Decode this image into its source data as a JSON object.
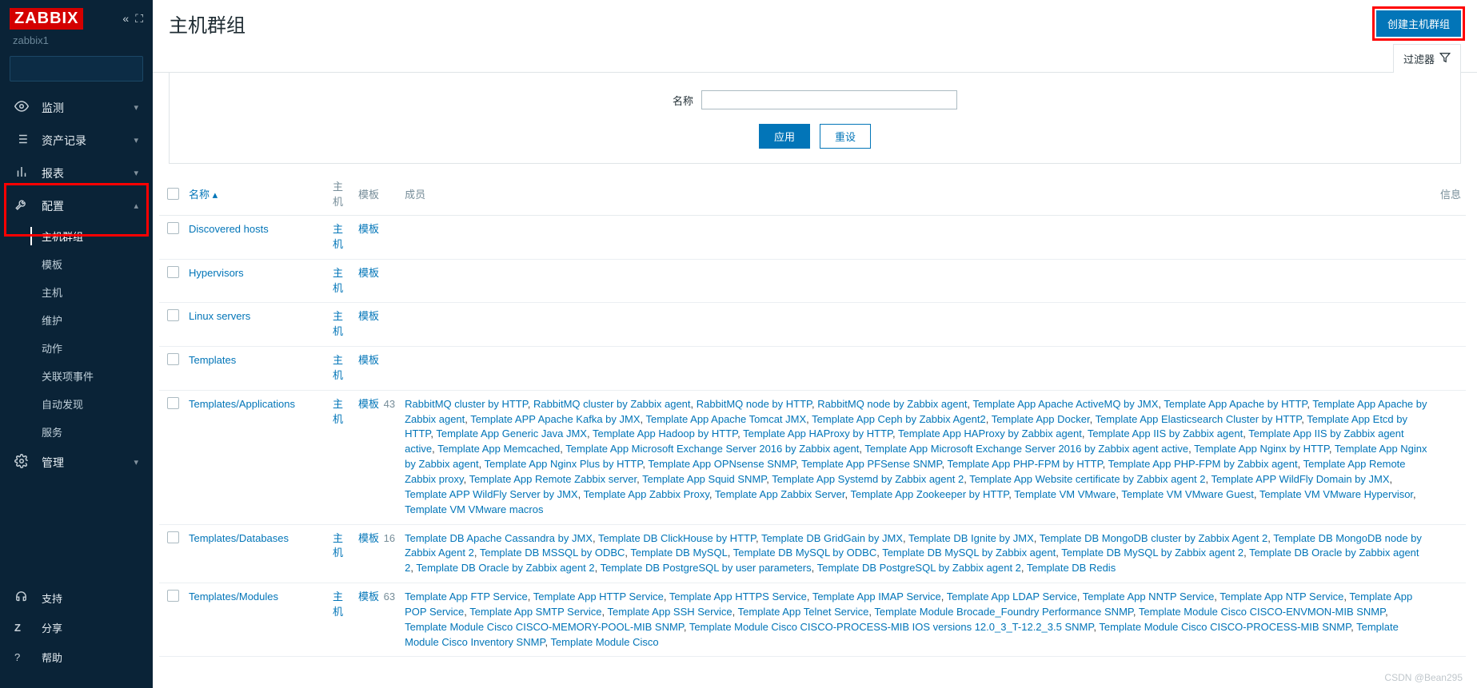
{
  "brand": "ZABBIX",
  "server": "zabbix1",
  "nav": {
    "monitor": "监测",
    "inventory": "资产记录",
    "reports": "报表",
    "config": "配置",
    "admin": "管理",
    "support": "支持",
    "share": "分享",
    "help": "帮助"
  },
  "config_sub": {
    "hostgroups": "主机群组",
    "templates": "模板",
    "hosts": "主机",
    "maintenance": "维护",
    "actions": "动作",
    "correlation": "关联项事件",
    "discovery": "自动发现",
    "services": "服务"
  },
  "page": {
    "title": "主机群组",
    "create_btn": "创建主机群组",
    "filter_tab": "过滤器",
    "filter_name_label": "名称",
    "apply": "应用",
    "reset": "重设"
  },
  "columns": {
    "name": "名称",
    "hosts": "主机",
    "templates": "模板",
    "members": "成员",
    "info": "信息"
  },
  "links": {
    "hosts": "主机",
    "templates": "模板"
  },
  "rows": [
    {
      "name": "Discovered hosts",
      "templates_count": null,
      "members": []
    },
    {
      "name": "Hypervisors",
      "templates_count": null,
      "members": []
    },
    {
      "name": "Linux servers",
      "templates_count": null,
      "members": []
    },
    {
      "name": "Templates",
      "templates_count": null,
      "members": []
    },
    {
      "name": "Templates/Applications",
      "templates_count": 43,
      "members": [
        "RabbitMQ cluster by HTTP",
        "RabbitMQ cluster by Zabbix agent",
        "RabbitMQ node by HTTP",
        "RabbitMQ node by Zabbix agent",
        "Template App Apache ActiveMQ by JMX",
        "Template App Apache by HTTP",
        "Template App Apache by Zabbix agent",
        "Template APP Apache Kafka by JMX",
        "Template App Apache Tomcat JMX",
        "Template App Ceph by Zabbix Agent2",
        "Template App Docker",
        "Template App Elasticsearch Cluster by HTTP",
        "Template App Etcd by HTTP",
        "Template App Generic Java JMX",
        "Template App Hadoop by HTTP",
        "Template App HAProxy by HTTP",
        "Template App HAProxy by Zabbix agent",
        "Template App IIS by Zabbix agent",
        "Template App IIS by Zabbix agent active",
        "Template App Memcached",
        "Template App Microsoft Exchange Server 2016 by Zabbix agent",
        "Template App Microsoft Exchange Server 2016 by Zabbix agent active",
        "Template App Nginx by HTTP",
        "Template App Nginx by Zabbix agent",
        "Template App Nginx Plus by HTTP",
        "Template App OPNsense SNMP",
        "Template App PFSense SNMP",
        "Template App PHP-FPM by HTTP",
        "Template App PHP-FPM by Zabbix agent",
        "Template App Remote Zabbix proxy",
        "Template App Remote Zabbix server",
        "Template App Squid SNMP",
        "Template App Systemd by Zabbix agent 2",
        "Template App Website certificate by Zabbix agent 2",
        "Template APP WildFly Domain by JMX",
        "Template APP WildFly Server by JMX",
        "Template App Zabbix Proxy",
        "Template App Zabbix Server",
        "Template App Zookeeper by HTTP",
        "Template VM VMware",
        "Template VM VMware Guest",
        "Template VM VMware Hypervisor",
        "Template VM VMware macros"
      ]
    },
    {
      "name": "Templates/Databases",
      "templates_count": 16,
      "members": [
        "Template DB Apache Cassandra by JMX",
        "Template DB ClickHouse by HTTP",
        "Template DB GridGain by JMX",
        "Template DB Ignite by JMX",
        "Template DB MongoDB cluster by Zabbix Agent 2",
        "Template DB MongoDB node by Zabbix Agent 2",
        "Template DB MSSQL by ODBC",
        "Template DB MySQL",
        "Template DB MySQL by ODBC",
        "Template DB MySQL by Zabbix agent",
        "Template DB MySQL by Zabbix agent 2",
        "Template DB Oracle by Zabbix agent 2",
        "Template DB Oracle by Zabbix agent 2",
        "Template DB PostgreSQL by user parameters",
        "Template DB PostgreSQL by Zabbix agent 2",
        "Template DB Redis"
      ]
    },
    {
      "name": "Templates/Modules",
      "templates_count": 63,
      "members": [
        "Template App FTP Service",
        "Template App HTTP Service",
        "Template App HTTPS Service",
        "Template App IMAP Service",
        "Template App LDAP Service",
        "Template App NNTP Service",
        "Template App NTP Service",
        "Template App POP Service",
        "Template App SMTP Service",
        "Template App SSH Service",
        "Template App Telnet Service",
        "Template Module Brocade_Foundry Performance SNMP",
        "Template Module Cisco CISCO-ENVMON-MIB SNMP",
        "Template Module Cisco CISCO-MEMORY-POOL-MIB SNMP",
        "Template Module Cisco CISCO-PROCESS-MIB IOS versions 12.0_3_T-12.2_3.5 SNMP",
        "Template Module Cisco CISCO-PROCESS-MIB SNMP",
        "Template Module Cisco Inventory SNMP",
        "Template Module Cisco"
      ]
    }
  ],
  "watermark": "CSDN @Bean295"
}
